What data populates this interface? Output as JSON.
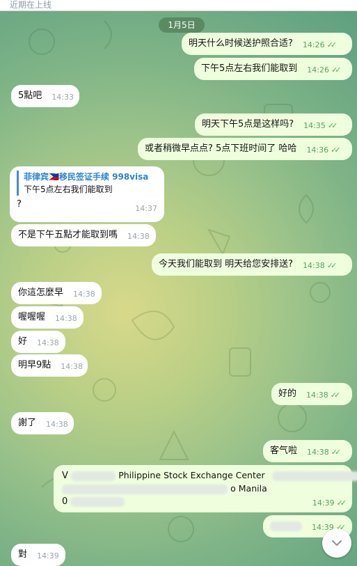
{
  "topbar": {
    "text": "近期在上线"
  },
  "date_pill": "1月5日",
  "messages": [
    {
      "text": "明天什么时候送护照合适?",
      "time": "14:26"
    },
    {
      "text": "下午5点左右我们能取到",
      "time": "14:26"
    },
    {
      "text": "5點吧",
      "time": "14:33"
    },
    {
      "text": "明天下午5点是这样吗?",
      "time": "14:35"
    },
    {
      "text": "或者稍微早点点? 5点下班时间了 哈哈",
      "time": "14:36"
    },
    {
      "reply_name": "菲律宾🇵🇭移民签证手续 998visa",
      "reply_text": "下午5点左右我们能取到",
      "text": "?",
      "time": "14:37"
    },
    {
      "text": "不是下午五點才能取到嗎",
      "time": "14:38"
    },
    {
      "text": "今天我们能取到 明天给您安排送?",
      "time": "14:38"
    },
    {
      "text": "你這怎麼早",
      "time": "14:38"
    },
    {
      "text": "喔喔喔",
      "time": "14:38"
    },
    {
      "text": "好",
      "time": "14:38"
    },
    {
      "text": "明早9點",
      "time": "14:38"
    },
    {
      "text": "好的",
      "time": "14:38"
    },
    {
      "text": "謝了",
      "time": "14:38"
    },
    {
      "text": "客气啦",
      "time": "14:38"
    },
    {
      "line1_prefix": "V",
      "line1_visible": "Philippine Stock Exchange Center",
      "line2_visible": "o Manila",
      "line3_prefix": "0",
      "time": "14:39"
    },
    {
      "text": "",
      "time": "14:39"
    },
    {
      "text": "對",
      "time": "14:39"
    }
  ],
  "icons": {
    "read_receipt": "double-check-icon",
    "scroll_down": "chevron-down-icon"
  },
  "colors": {
    "outgoing_bubble": "#efffde",
    "incoming_bubble": "#ffffff",
    "accent": "#4fae4e",
    "reply_name": "#2a85d3"
  }
}
